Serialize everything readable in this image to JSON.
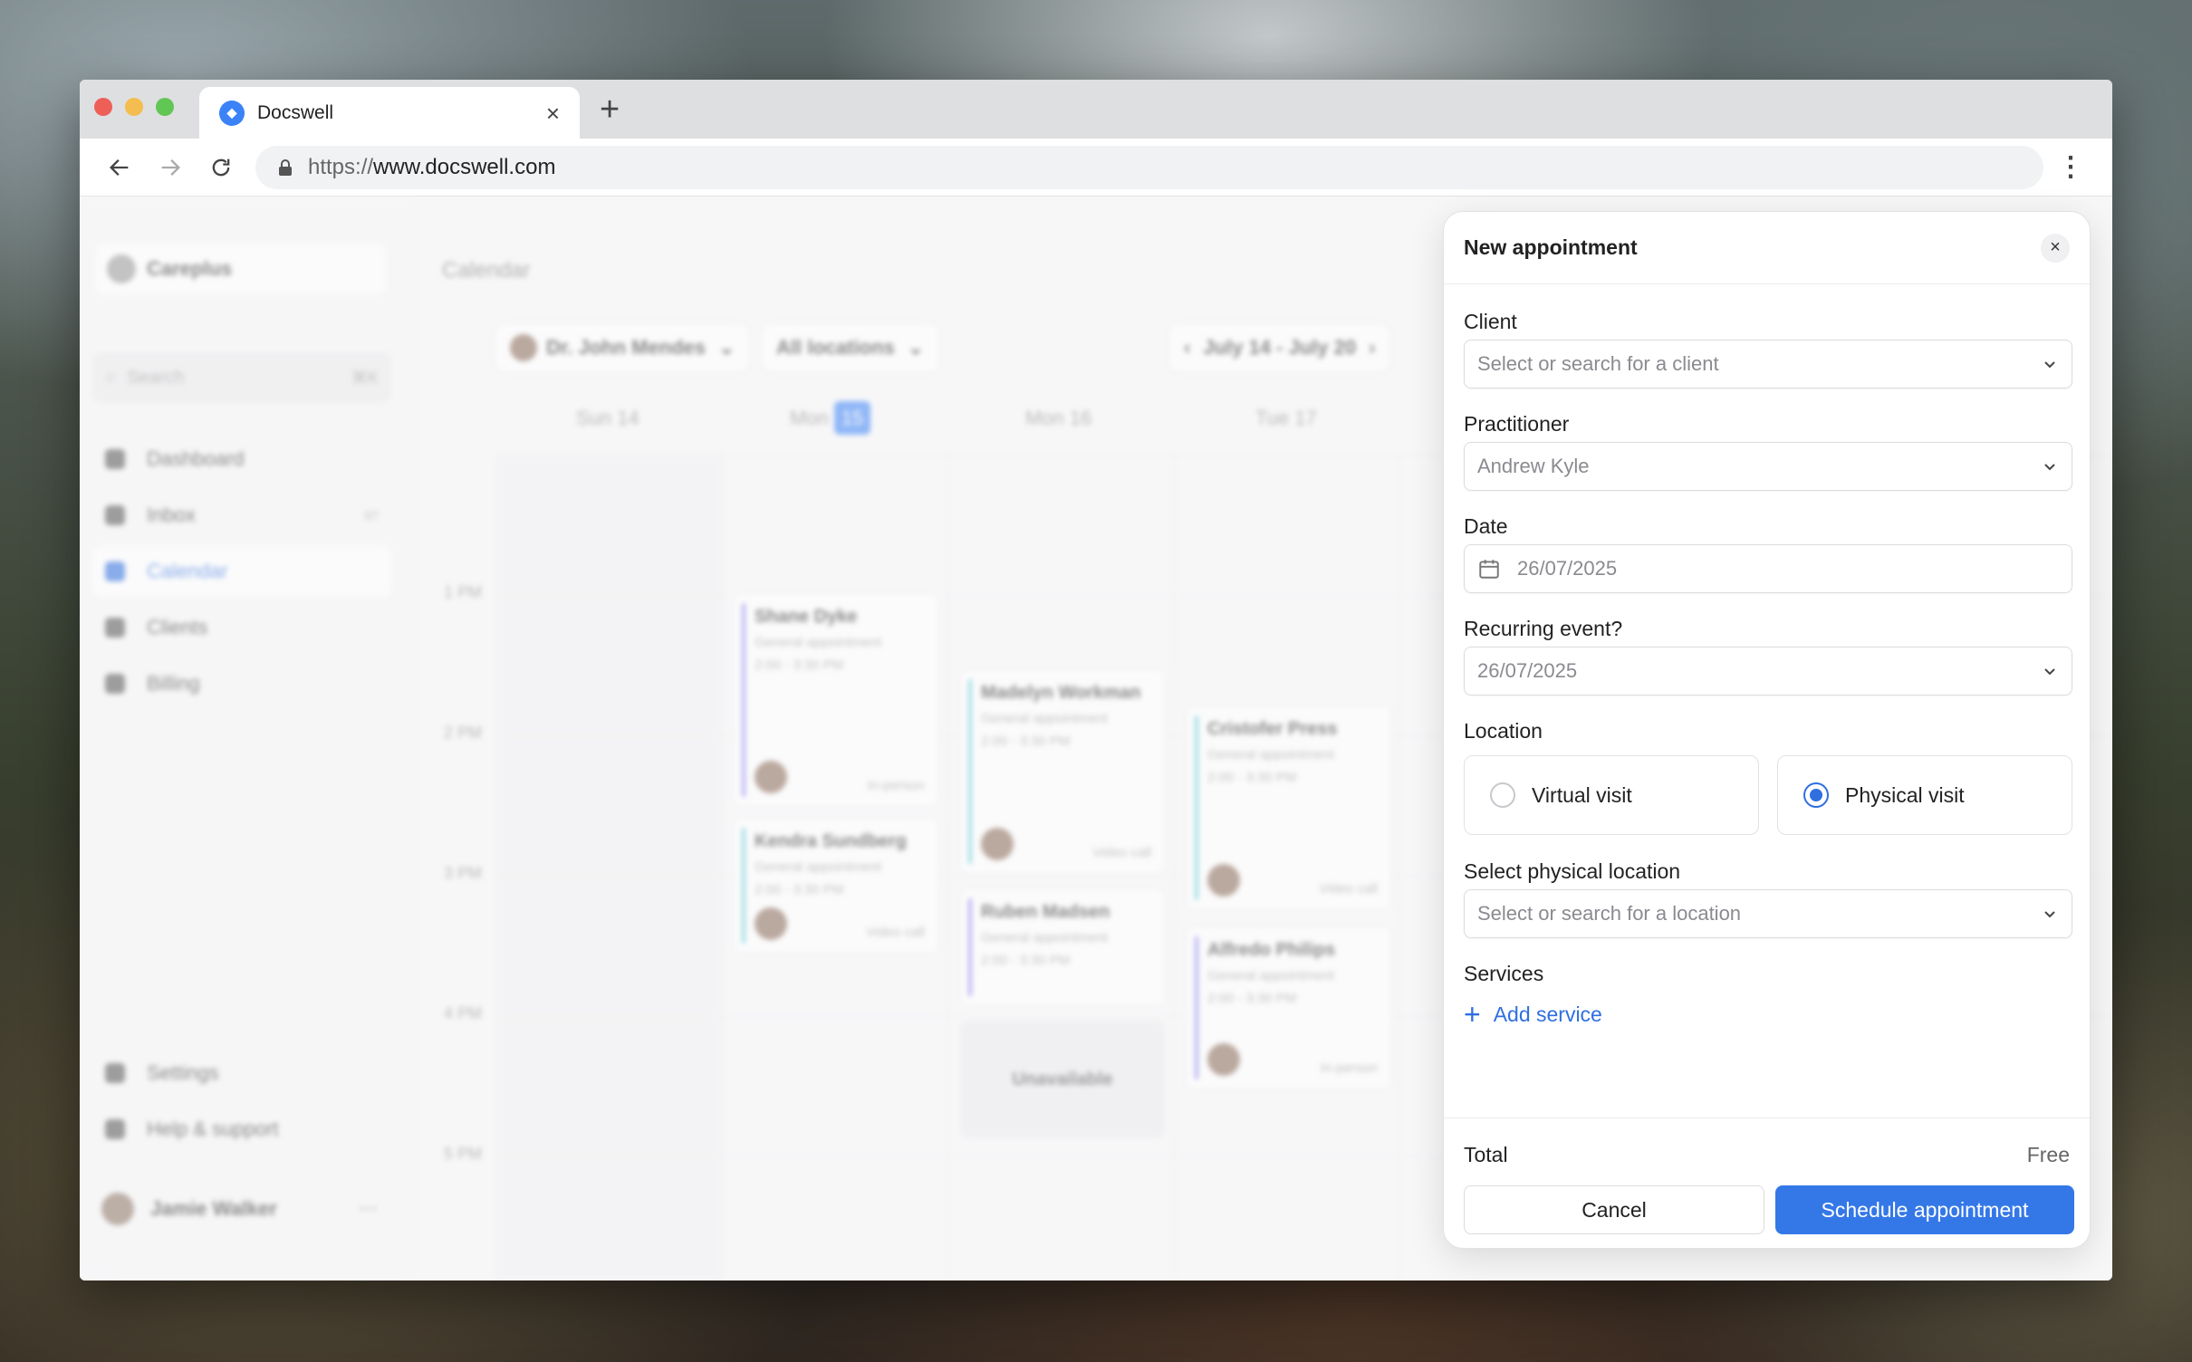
{
  "browser": {
    "tab_title": "Docswell",
    "new_tab": "+",
    "url_scheme": "https://",
    "url_host": "www.docswell.com"
  },
  "sidebar": {
    "org_name": "Careplus",
    "search_placeholder": "Search",
    "search_shortcut": "⌘K",
    "items": [
      {
        "label": "Dashboard"
      },
      {
        "label": "Inbox",
        "count": "97"
      },
      {
        "label": "Calendar"
      },
      {
        "label": "Clients"
      },
      {
        "label": "Billing"
      }
    ],
    "bottom_items": [
      {
        "label": "Settings"
      },
      {
        "label": "Help & support"
      }
    ],
    "user_name": "Jamie Walker"
  },
  "calendar": {
    "title": "Calendar",
    "practitioner_filter": "Dr. John Mendes",
    "location_filter": "All locations",
    "date_range": "July 14 - July 20",
    "days": [
      "Sun 14",
      "Mon",
      "Mon 16",
      "Tue 17"
    ],
    "today_badge": "15",
    "times": [
      "1 PM",
      "2 PM",
      "3 PM",
      "4 PM",
      "5 PM"
    ],
    "appointments": [
      {
        "name": "Shane Dyke",
        "type": "General appointment",
        "time": "2:00 - 3:30 PM",
        "mode": "In-person"
      },
      {
        "name": "Kendra Sundberg",
        "type": "General appointment",
        "time": "2:00 - 3:30 PM",
        "mode": "Video call"
      },
      {
        "name": "Madelyn Workman",
        "type": "General appointment",
        "time": "2:00 - 3:30 PM",
        "mode": "Video call"
      },
      {
        "name": "Ruben Madsen",
        "type": "General appointment",
        "time": "2:00 - 3:30 PM",
        "mode": ""
      },
      {
        "name": "Cristofer Press",
        "type": "General appointment",
        "time": "2:00 - 3:30 PM",
        "mode": "Video call"
      },
      {
        "name": "Alfredo Philips",
        "type": "General appointment",
        "time": "2:00 - 3:30 PM",
        "mode": "In-person"
      }
    ],
    "unavailable": "Unavailable"
  },
  "modal": {
    "title": "New appointment",
    "client_label": "Client",
    "client_placeholder": "Select or search for a client",
    "practitioner_label": "Practitioner",
    "practitioner_value": "Andrew Kyle",
    "date_label": "Date",
    "date_value": "26/07/2025",
    "recurring_label": "Recurring event?",
    "recurring_value": "26/07/2025",
    "location_label": "Location",
    "virtual_visit": "Virtual visit",
    "physical_visit": "Physical visit",
    "physical_location_label": "Select physical location",
    "physical_location_placeholder": "Select or search for a location",
    "services_label": "Services",
    "add_service": "Add service",
    "total_label": "Total",
    "total_value": "Free",
    "cancel": "Cancel",
    "schedule": "Schedule appointment"
  },
  "colors": {
    "accent": "#3478e8",
    "appt_purple": "#8b7cf0",
    "appt_teal": "#5cc9d6"
  }
}
